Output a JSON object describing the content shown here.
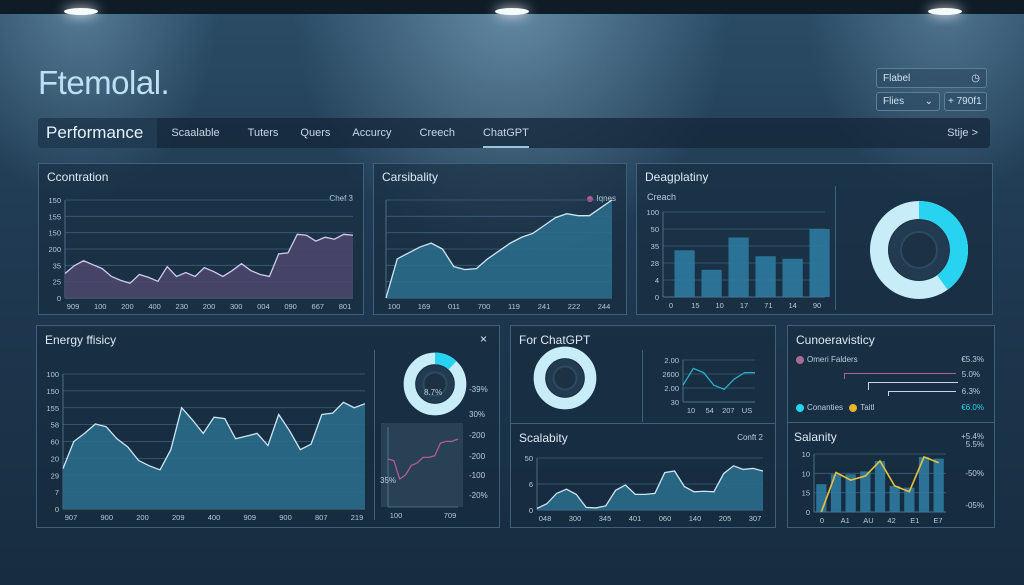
{
  "header": {
    "title": "Ftemolal.",
    "label_field": "Flabel",
    "select_value": "Flies",
    "action_button": "+ 790f1"
  },
  "nav": {
    "brand": "Performance",
    "items": [
      "Scaalable",
      "Tuters",
      "Quers",
      "Accurcy",
      "Creech",
      "ChatGPT"
    ],
    "active": "ChatGPT",
    "right": "Stije >"
  },
  "colors": {
    "accent": "#27d3f0",
    "purple_area": "#4a476c",
    "teal_area": "#2a6b8a",
    "yellow": "#e8c23a",
    "pink": "#b45a96"
  },
  "panels": {
    "contration": {
      "title": "Ccontration"
    },
    "carsibality": {
      "title": "Carsibality"
    },
    "deagplatiny": {
      "title": "Deagplatiny",
      "subtitle": "Creach"
    },
    "energy": {
      "title": "Energy ffisicy",
      "close": "×",
      "donut_label": "8.7%",
      "right_labels": [
        "-39%",
        "30%",
        "-200",
        "-200",
        "-100",
        "-20%"
      ],
      "mini_label": "35%"
    },
    "forchatgpt": {
      "title": "For ChatGPT"
    },
    "scalabity": {
      "title": "Scalabity"
    },
    "cunoeravisticy": {
      "title": "Cunoeravisticy",
      "legend1": "Omeri Falders",
      "legend2": "Conanties",
      "legend3": "Taitl",
      "values": [
        "€5.3%",
        "5.0%",
        "6.3%",
        "€6.0%"
      ]
    },
    "salanity": {
      "title": "Salanity",
      "right_labels": [
        "+5.4%",
        "5.5%",
        "-50%",
        "-05%"
      ]
    }
  },
  "chart_data": [
    {
      "id": "contration",
      "type": "area",
      "legend": "Chef 3",
      "yticks": [
        "150",
        "155",
        "150",
        "200",
        "35",
        "25",
        "0"
      ],
      "xticks": [
        "909",
        "100",
        "200",
        "400",
        "230",
        "200",
        "300",
        "004",
        "090",
        "667",
        "801"
      ],
      "ylim": [
        0,
        100
      ],
      "values": [
        25,
        33,
        38,
        34,
        30,
        22,
        18,
        15,
        24,
        21,
        17,
        32,
        22,
        26,
        22,
        31,
        27,
        22,
        28,
        35,
        28,
        24,
        22,
        45,
        46,
        65,
        64,
        58,
        62,
        60,
        65,
        64
      ]
    },
    {
      "id": "carsibality",
      "type": "area",
      "legend": "Iqnes",
      "yticks": [
        "",
        "",
        "",
        "",
        "",
        "",
        ""
      ],
      "xticks": [
        "100",
        "169",
        "011",
        "700",
        "119",
        "241",
        "222",
        "244"
      ],
      "ylim": [
        0,
        100
      ],
      "values": [
        0,
        40,
        46,
        52,
        56,
        50,
        32,
        29,
        30,
        40,
        48,
        56,
        62,
        66,
        74,
        82,
        86,
        84,
        84,
        92,
        100
      ]
    },
    {
      "id": "deagplatiny",
      "type": "bar",
      "yticks": [
        "100",
        "50",
        "35",
        "28",
        "4",
        "0"
      ],
      "xticks": [
        "0",
        "15",
        "10",
        "17",
        "71",
        "14",
        "90"
      ],
      "ylim": [
        0,
        100
      ],
      "values": [
        55,
        32,
        70,
        48,
        45,
        80
      ]
    },
    {
      "id": "deag-donut",
      "type": "pie",
      "values": [
        40,
        60
      ]
    },
    {
      "id": "energy",
      "type": "area",
      "yticks": [
        "100",
        "150",
        "155",
        "58",
        "60",
        "20",
        "29",
        "7",
        "0"
      ],
      "xticks": [
        "907",
        "900",
        "200",
        "209",
        "400",
        "909",
        "900",
        "807",
        "219"
      ],
      "ylim": [
        0,
        100
      ],
      "values": [
        30,
        50,
        56,
        63,
        61,
        52,
        46,
        36,
        32,
        29,
        44,
        75,
        66,
        56,
        68,
        67,
        52,
        54,
        56,
        47,
        70,
        58,
        44,
        48,
        70,
        71,
        79,
        75,
        78
      ]
    },
    {
      "id": "energy-mini",
      "type": "line",
      "xticks": [
        "100",
        "709"
      ],
      "ylim": [
        0,
        100
      ],
      "values": [
        60,
        58,
        35,
        40,
        52,
        55,
        62,
        62,
        64,
        80,
        82,
        82,
        85
      ]
    },
    {
      "id": "energy-donut",
      "type": "pie",
      "values": [
        12,
        88
      ]
    },
    {
      "id": "chatgpt-donut",
      "type": "pie",
      "values": [
        0,
        100
      ]
    },
    {
      "id": "chatgpt-mini",
      "type": "line",
      "yticks": [
        "2.00",
        "2600",
        "2.00",
        "30"
      ],
      "xticks": [
        "10",
        "54",
        "207",
        "US"
      ],
      "ylim": [
        0,
        100
      ],
      "values": [
        40,
        80,
        70,
        40,
        30,
        55,
        70,
        70
      ]
    },
    {
      "id": "scalabity",
      "type": "area",
      "legend": "Conft 2",
      "yticks": [
        "50",
        "6",
        "0"
      ],
      "xticks": [
        "048",
        "300",
        "345",
        "401",
        "060",
        "140",
        "205",
        "307"
      ],
      "ylim": [
        0,
        100
      ],
      "values": [
        3,
        12,
        32,
        40,
        30,
        5,
        4,
        8,
        38,
        48,
        30,
        30,
        32,
        72,
        75,
        45,
        35,
        36,
        35,
        70,
        85,
        78,
        80,
        75
      ]
    },
    {
      "id": "salanity",
      "type": "combo",
      "yticks": [
        "10",
        "10",
        "15",
        "0"
      ],
      "xticks": [
        "0",
        "A1",
        "AU",
        "42",
        "E1",
        "E7"
      ],
      "ylim": [
        0,
        100
      ],
      "values": [
        48,
        65,
        65,
        70,
        88,
        45,
        42,
        95,
        92
      ],
      "line": [
        0,
        68,
        55,
        62,
        88,
        45,
        35,
        95,
        85
      ]
    }
  ]
}
